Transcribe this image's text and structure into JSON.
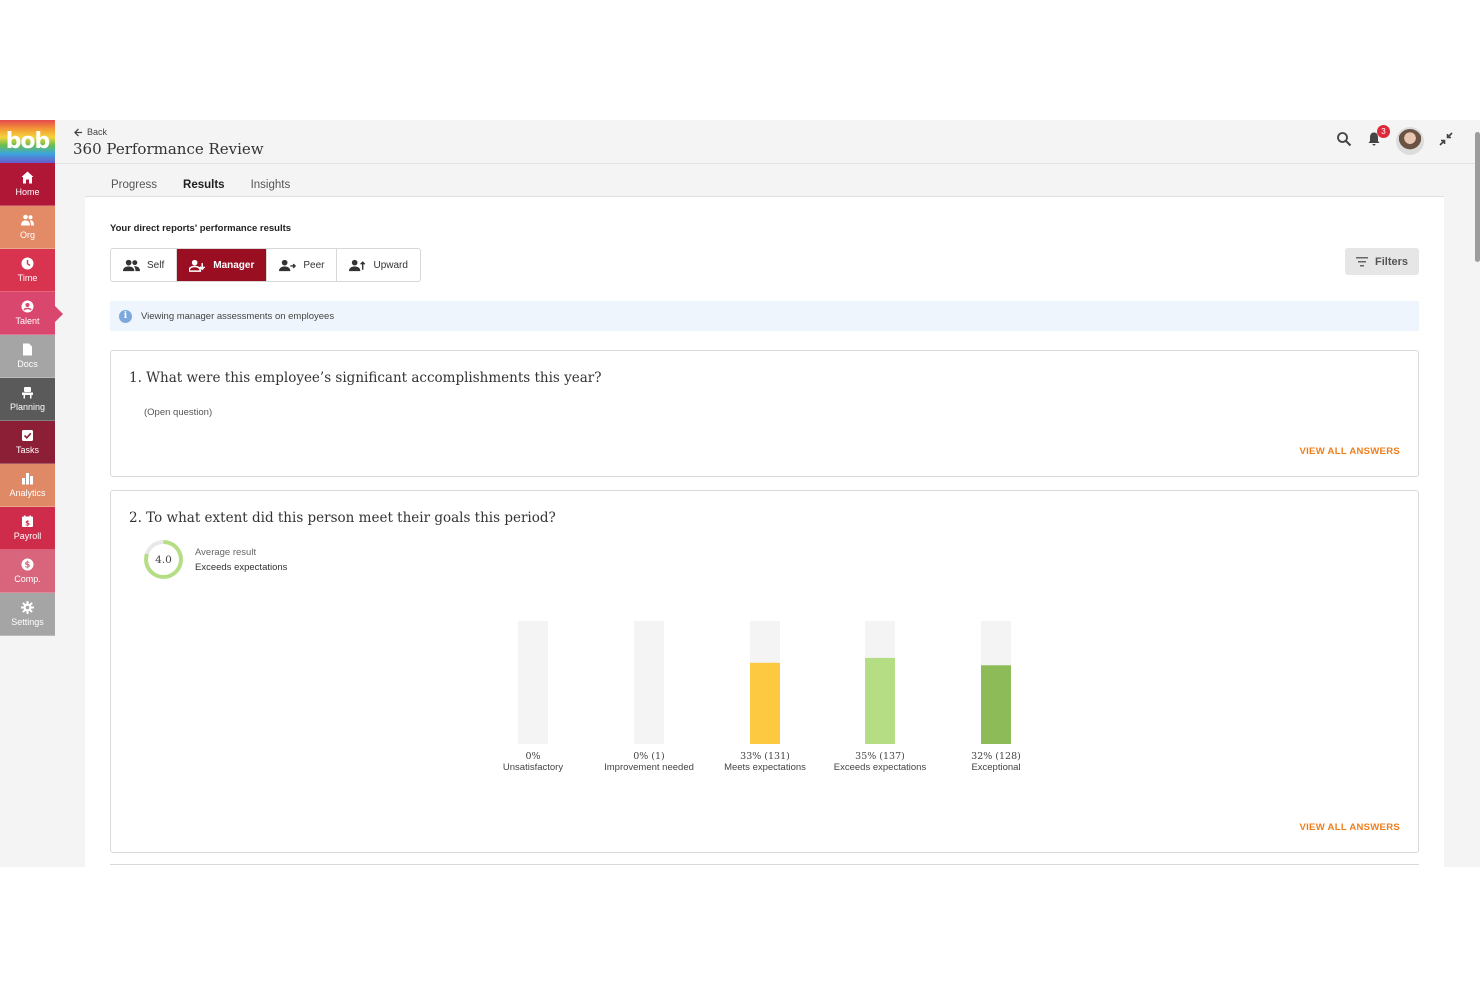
{
  "app": {
    "logo": "bob",
    "back_label": "Back",
    "title": "360 Performance Review",
    "notification_count": "3"
  },
  "sidebar": {
    "items": [
      {
        "label": "Home",
        "icon": "home-icon",
        "color": "#b01737"
      },
      {
        "label": "Org",
        "icon": "people-icon",
        "color": "#e38a66"
      },
      {
        "label": "Time",
        "icon": "clock-icon",
        "color": "#d9344f"
      },
      {
        "label": "Talent",
        "icon": "talent-icon",
        "color": "#d9466e"
      },
      {
        "label": "Docs",
        "icon": "document-icon",
        "color": "#a5a5a5"
      },
      {
        "label": "Planning",
        "icon": "planning-icon",
        "color": "#5a5a5a"
      },
      {
        "label": "Tasks",
        "icon": "task-icon",
        "color": "#8c1e35"
      },
      {
        "label": "Analytics",
        "icon": "analytics-icon",
        "color": "#e08967"
      },
      {
        "label": "Payroll",
        "icon": "payroll-icon",
        "color": "#cf2b4a"
      },
      {
        "label": "Comp.",
        "icon": "dollar-icon",
        "color": "#d9657d"
      },
      {
        "label": "Settings",
        "icon": "gear-icon",
        "color": "#a5a5a5"
      }
    ]
  },
  "tabs": [
    {
      "label": "Progress",
      "active": false
    },
    {
      "label": "Results",
      "active": true
    },
    {
      "label": "Insights",
      "active": false
    }
  ],
  "results": {
    "section_title": "Your direct reports' performance results",
    "segments": [
      {
        "label": "Self",
        "icon": "people-icon"
      },
      {
        "label": "Manager",
        "icon": "manager-icon"
      },
      {
        "label": "Peer",
        "icon": "peer-icon"
      },
      {
        "label": "Upward",
        "icon": "upward-icon"
      }
    ],
    "filters_label": "Filters",
    "info_text": "Viewing manager assessments on employees"
  },
  "questions": [
    {
      "title": "1. What were this employee’s significant accomplishments this year?",
      "note": "(Open question)",
      "view_all": "VIEW ALL ANSWERS"
    },
    {
      "title": "2. To what extent did this person meet their goals this period?",
      "avg_score": "4.0",
      "avg_label": "Average result",
      "avg_value": "Exceeds expectations",
      "view_all": "VIEW ALL ANSWERS"
    }
  ],
  "chart_data": {
    "type": "bar",
    "categories": [
      "Unsatisfactory",
      "Improvement needed",
      "Meets expectations",
      "Exceeds expectations",
      "Exceptional"
    ],
    "values": [
      0,
      0,
      33,
      35,
      32
    ],
    "counts": [
      null,
      1,
      131,
      137,
      128
    ],
    "value_labels": [
      "0%",
      "0% (1)",
      "33% (131)",
      "35% (137)",
      "32% (128)"
    ],
    "colors": [
      "#e0e0e0",
      "#e0e0e0",
      "#fdc940",
      "#b5de84",
      "#8dbb57"
    ],
    "track_color": "#f4f4f4",
    "ylim": [
      0,
      100
    ]
  }
}
